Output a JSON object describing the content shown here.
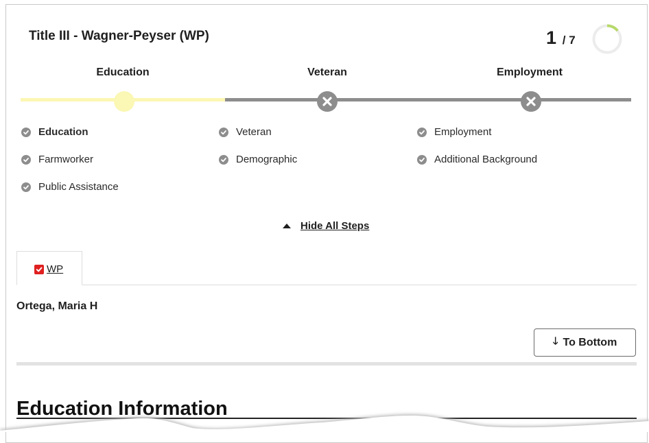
{
  "header": {
    "title": "Title III - Wagner-Peyser (WP)",
    "current_step": "1",
    "total_steps": "7",
    "progress_fraction": 0.142857
  },
  "stepper": {
    "steps": [
      {
        "label": "Education",
        "status": "current"
      },
      {
        "label": "Veteran",
        "status": "incomplete"
      },
      {
        "label": "Employment",
        "status": "incomplete"
      }
    ],
    "colors": {
      "active": "#fbf7b4",
      "inactive": "#8d8d8d",
      "progress_arc": "#b7d96a"
    }
  },
  "substeps": {
    "col1": [
      "Education",
      "Farmworker",
      "Public Assistance"
    ],
    "col2": [
      "Veteran",
      "Demographic"
    ],
    "col3": [
      "Employment",
      "Additional Background"
    ]
  },
  "toggle_steps": {
    "label": "Hide All Steps"
  },
  "tabs": [
    {
      "label": "WP",
      "checked": true
    }
  ],
  "participant": {
    "name": "Ortega, Maria H"
  },
  "to_bottom": {
    "label": "To Bottom"
  },
  "section": {
    "title": "Education Information"
  }
}
